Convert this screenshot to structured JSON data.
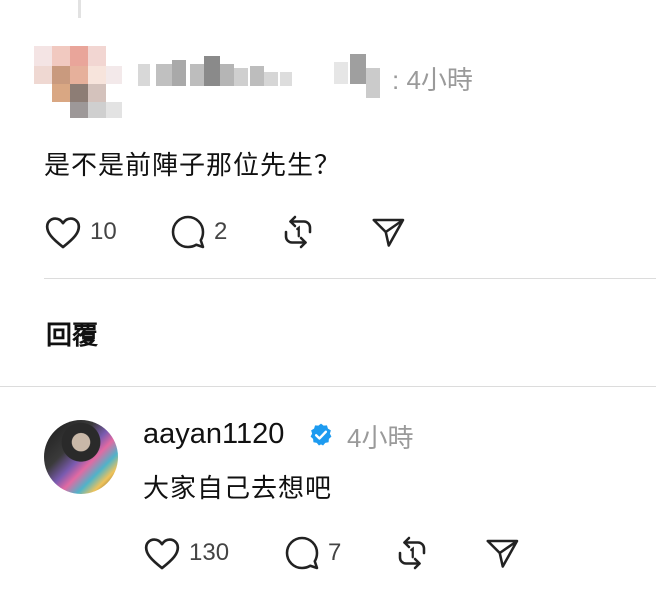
{
  "post": {
    "time": ": 4小時",
    "text": "是不是前陣子那位先生？",
    "likes": "10",
    "comments": "2"
  },
  "replies_label": "回覆",
  "reply": {
    "username": "aayan1120",
    "time": "4小時",
    "text": "大家自己去想吧",
    "likes": "130",
    "comments": "7"
  },
  "colors": {
    "verified": "#1d9bf0",
    "muted_text": "#9a9a9a",
    "divider": "#dcdcdc"
  },
  "icons": [
    "heart-icon",
    "comment-icon",
    "repost-icon",
    "share-icon",
    "verified-badge-icon"
  ]
}
